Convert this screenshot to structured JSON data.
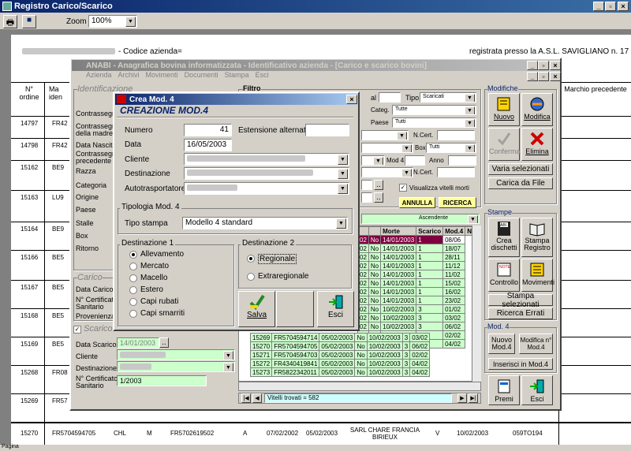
{
  "app": {
    "title": "Registro Carico/Scarico",
    "zoom_label": "Zoom",
    "zoom_value": "100%"
  },
  "report": {
    "codice_label": "- Codice azienda=",
    "registrata": "registrata presso la A.S.L. SAVIGLIANO n. 17",
    "headers": {
      "n_ordine": "N° ordine",
      "ma": "Ma iden",
      "marchio_prec": "Marchio precedente"
    },
    "rows": [
      {
        "n": "14797",
        "m": "FR42"
      },
      {
        "n": "14798",
        "m": "FR42"
      },
      {
        "n": "15162",
        "m": "BE9"
      },
      {
        "n": "15163",
        "m": "LU9"
      },
      {
        "n": "15164",
        "m": "BE9"
      },
      {
        "n": "15166",
        "m": "BE5"
      },
      {
        "n": "15167",
        "m": "BE5"
      },
      {
        "n": "15168",
        "m": "BE5"
      },
      {
        "n": "15169",
        "m": "BE5"
      },
      {
        "n": "15268",
        "m": "FR08"
      },
      {
        "n": "15269",
        "m": "FR57"
      }
    ],
    "last_row": {
      "n": "15270",
      "m": "FR5704594705",
      "razza": "CHL",
      "sesso": "M",
      "marchio_madre": "FR5702619502",
      "a": "A",
      "nascita": "07/02/2002",
      "carico": "05/02/2003",
      "cliente": "SARL CHARE FRANCIA BIRIEUX",
      "v": "V",
      "scarico": "10/02/2003",
      "mod4": "059TO194"
    },
    "status": "Pagina"
  },
  "anabi": {
    "title": "ANABI - Anagrafica bovina informatizzata - Identificativo azienda - [Carico e scarico bovini]",
    "menu": [
      "Azienda",
      "Archivi",
      "Movimenti",
      "Documenti",
      "Stampa",
      "Esci"
    ],
    "ident": {
      "title": "Identificazione",
      "labels": [
        "Contrassegno",
        "Contrassegno della madre",
        "Data Nascita",
        "Contrassegno precedente",
        "Razza",
        "Categoria",
        "Origine",
        "Paese",
        "Stalle",
        "Box",
        "Ritorno"
      ]
    },
    "carico": {
      "title": "Carico",
      "labels": [
        "Data Carico",
        "N° Certificato Sanitario",
        "Provenienza"
      ]
    },
    "scarico": {
      "title": "Scarico",
      "data_label": "Data Scarico",
      "data_value": "14/01/2003",
      "cliente_label": "Cliente",
      "dest_label": "Destinazione",
      "cert_label": "N° Certificato Sanitario",
      "cert_value": "1/2003"
    },
    "filtro": {
      "title": "Filtro",
      "al": "al",
      "tipo_label": "Tipo",
      "tipo_value": "Scaricati",
      "categ_label": "Categ.",
      "categ_value": "Tutte",
      "paese_label": "Paese",
      "paese_value": "Tutti",
      "ncert": "N.Cert.",
      "box_label": "Box",
      "box_value": "Tutti",
      "mod4": "Mod 4",
      "anno": "Anno",
      "ncert2": "N.Cert.",
      "vis_label": "Visualizza vitelli morti",
      "annulla": "ANNULLA",
      "ricerca": "RICERCA",
      "ord": "Ascendente"
    },
    "grid": {
      "headers": [
        "Morte",
        "Scarico",
        "Mod.4",
        "Nasc"
      ],
      "rows": [
        {
          "c0": "02",
          "c1": "No",
          "c2": "14/01/2003",
          "c3": "1",
          "c4": "08/06",
          "sel": true
        },
        {
          "c0": "02",
          "c1": "No",
          "c2": "14/01/2003",
          "c3": "1",
          "c4": "18/07"
        },
        {
          "c0": "02",
          "c1": "No",
          "c2": "14/01/2003",
          "c3": "1",
          "c4": "28/11"
        },
        {
          "c0": "02",
          "c1": "No",
          "c2": "14/01/2003",
          "c3": "1",
          "c4": "11/12"
        },
        {
          "c0": "02",
          "c1": "No",
          "c2": "14/01/2003",
          "c3": "1",
          "c4": "11/02"
        },
        {
          "c0": "02",
          "c1": "No",
          "c2": "14/01/2003",
          "c3": "1",
          "c4": "15/02"
        },
        {
          "c0": "02",
          "c1": "No",
          "c2": "14/01/2003",
          "c3": "1",
          "c4": "16/02"
        },
        {
          "c0": "02",
          "c1": "No",
          "c2": "14/01/2003",
          "c3": "1",
          "c4": "23/02"
        },
        {
          "c0": "02",
          "c1": "No",
          "c2": "10/02/2003",
          "c3": "3",
          "c4": "01/02"
        },
        {
          "c0": "02",
          "c1": "No",
          "c2": "10/02/2003",
          "c3": "3",
          "c4": "03/02"
        },
        {
          "c0": "02",
          "c1": "No",
          "c2": "10/02/2003",
          "c3": "3",
          "c4": "06/02"
        },
        {
          "c0": "02",
          "c1": "No",
          "c2": "10/02/2003",
          "c3": "3",
          "c4": "02/02"
        },
        {
          "c0": "02",
          "c1": "No",
          "c2": "10/02/2003",
          "c3": "3",
          "c4": "04/02"
        }
      ],
      "full_rows": [
        {
          "n": "15269",
          "marchio": "FR5704594714",
          "data": "05/02/2003",
          "m": "No",
          "s": "10/02/2003",
          "mod": "3",
          "nasc": "03/02"
        },
        {
          "n": "15270",
          "marchio": "FR5704594705",
          "data": "05/02/2003",
          "m": "No",
          "s": "10/02/2003",
          "mod": "3",
          "nasc": "06/02"
        },
        {
          "n": "15271",
          "marchio": "FR5704594703",
          "data": "05/02/2003",
          "m": "No",
          "s": "10/02/2003",
          "mod": "3",
          "nasc": "02/02"
        },
        {
          "n": "15272",
          "marchio": "FR4340419841",
          "data": "05/02/2003",
          "m": "No",
          "s": "10/02/2003",
          "mod": "3",
          "nasc": "04/02"
        },
        {
          "n": "15273",
          "marchio": "FR5822342011",
          "data": "05/02/2003",
          "m": "No",
          "s": "10/02/2003",
          "mod": "3",
          "nasc": "04/02"
        }
      ],
      "found": "Vitelli trovati = 582"
    },
    "modifiche": {
      "title": "Modifiche",
      "nuovo": "Nuovo",
      "modifica": "Modifica",
      "conferma": "Conferma",
      "elimina": "Elimina",
      "varia": "Varia selezionati",
      "carica": "Carica da File"
    },
    "stampe": {
      "title": "Stampe",
      "crea": "Crea dischetti",
      "registro": "Stampa Registro",
      "controllo": "Controllo",
      "movimenti": "Movimenti",
      "sel": "Stampa selezionati",
      "errati": "Ricerca Errati"
    },
    "mod4": {
      "title": "Mod. 4",
      "nuovo": "Nuovo Mod.4",
      "modifica": "Modifica n° Mod.4",
      "inserisci": "Inserisci in Mod.4",
      "premi": "Premi",
      "esci": "Esci"
    }
  },
  "dialog": {
    "title": "Crea Mod. 4",
    "heading": "CREAZIONE MOD.4",
    "numero_label": "Numero",
    "numero_value": "41",
    "est_label": "Estensione alternativa",
    "data_label": "Data",
    "data_value": "16/05/2003",
    "cliente_label": "Cliente",
    "dest_label": "Destinazione",
    "auto_label": "Autotrasportatore",
    "tipologia": "Tipologia Mod. 4",
    "tipo_label": "Tipo stampa",
    "tipo_value": "Modello 4 standard",
    "dest1": "Destinazione 1",
    "dest1_opts": [
      "Allevamento",
      "Mercato",
      "Macello",
      "Estero",
      "Capi rubati",
      "Capi smarriti"
    ],
    "dest2": "Destinazione 2",
    "dest2_opts": [
      "Regionale",
      "Extraregionale"
    ],
    "salva": "Salva",
    "esci": "Esci"
  }
}
